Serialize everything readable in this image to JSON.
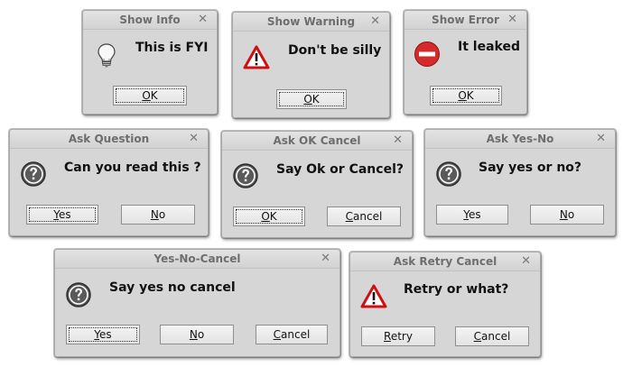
{
  "dialogs": [
    {
      "title": "Show Info",
      "message": "This is FYI",
      "icon": "lightbulb-icon",
      "buttons": [
        {
          "label": "OK",
          "mnemonic_index": 0
        }
      ]
    },
    {
      "title": "Show Warning",
      "message": "Don't be silly",
      "icon": "warning-icon",
      "buttons": [
        {
          "label": "OK",
          "mnemonic_index": 0
        }
      ]
    },
    {
      "title": "Show Error",
      "message": "It leaked",
      "icon": "error-icon",
      "buttons": [
        {
          "label": "OK",
          "mnemonic_index": 0
        }
      ]
    },
    {
      "title": "Ask Question",
      "message": "Can you read this ?",
      "icon": "question-icon",
      "buttons": [
        {
          "label": "Yes",
          "mnemonic_index": 0
        },
        {
          "label": "No",
          "mnemonic_index": 0
        }
      ]
    },
    {
      "title": "Ask OK Cancel",
      "message": "Say Ok or Cancel?",
      "icon": "question-icon",
      "buttons": [
        {
          "label": "OK",
          "mnemonic_index": 0
        },
        {
          "label": "Cancel",
          "mnemonic_index": 0
        }
      ]
    },
    {
      "title": "Ask Yes-No",
      "message": "Say yes or no?",
      "icon": "question-icon",
      "buttons": [
        {
          "label": "Yes",
          "mnemonic_index": 0
        },
        {
          "label": "No",
          "mnemonic_index": 0
        }
      ]
    },
    {
      "title": "Yes-No-Cancel",
      "message": "Say yes no cancel",
      "icon": "question-icon",
      "buttons": [
        {
          "label": "Yes",
          "mnemonic_index": 0
        },
        {
          "label": "No",
          "mnemonic_index": 0
        },
        {
          "label": "Cancel",
          "mnemonic_index": 0
        }
      ]
    },
    {
      "title": "Ask Retry Cancel",
      "message": "Retry or what?",
      "icon": "warning-icon",
      "buttons": [
        {
          "label": "Retry",
          "mnemonic_index": 0
        },
        {
          "label": "Cancel",
          "mnemonic_index": 0
        }
      ]
    }
  ],
  "close_glyph": "✕"
}
